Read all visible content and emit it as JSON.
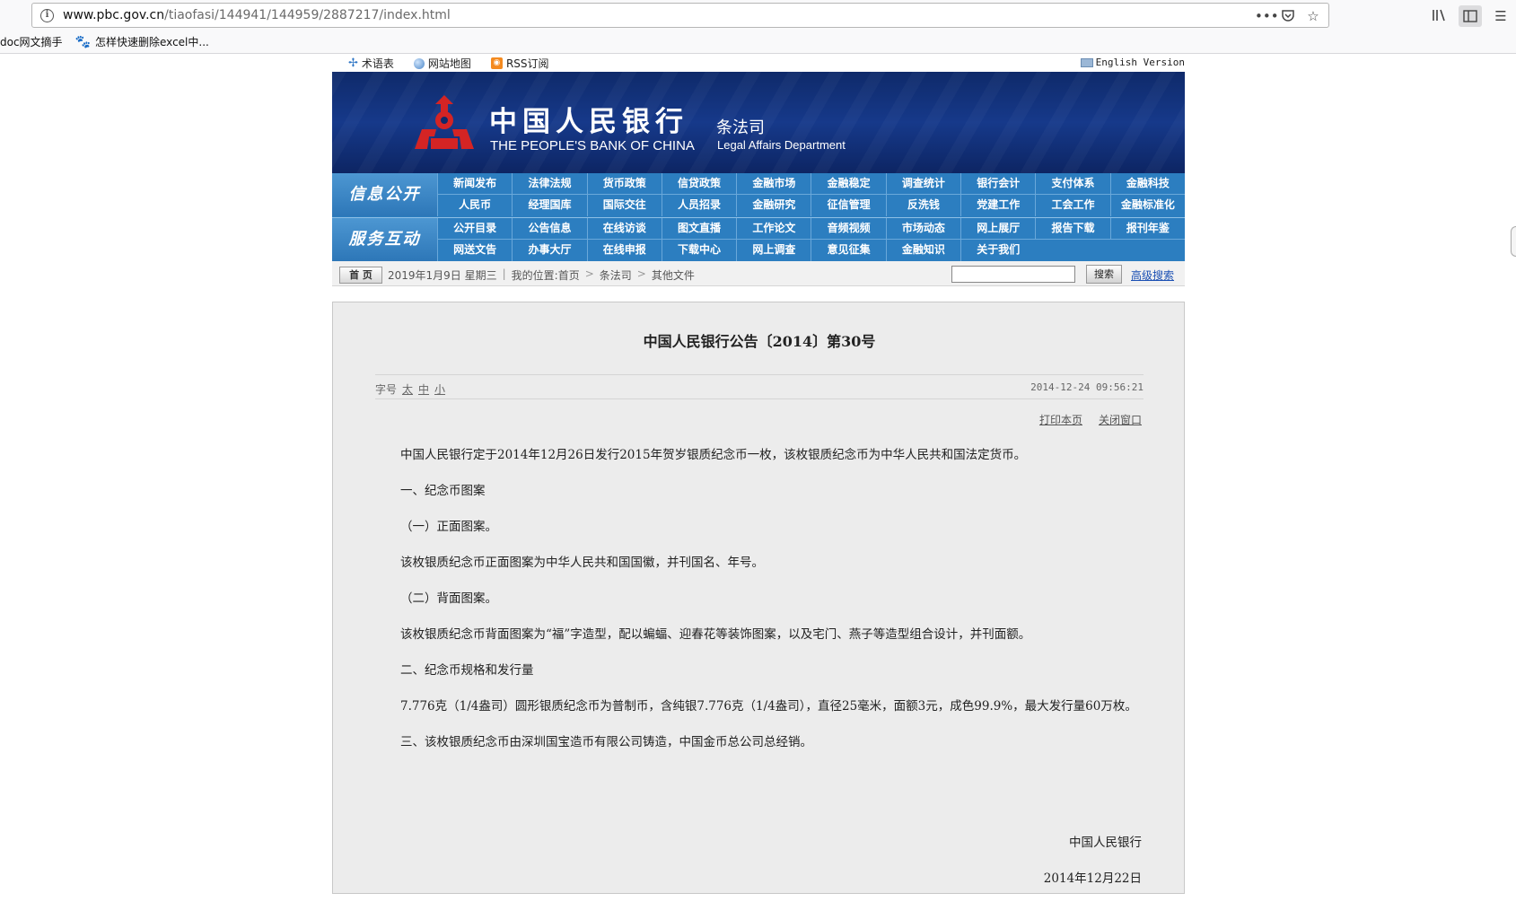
{
  "browser": {
    "url_host": "www.pbc.gov.cn",
    "url_path": "/tiaofasi/144941/144959/2887217/index.html",
    "bookmarks": [
      "doc网文摘手",
      "怎样快速删除excel中..."
    ]
  },
  "topbar": {
    "links": [
      "术语表",
      "网站地图",
      "RSS订阅"
    ],
    "english": "English Version"
  },
  "banner": {
    "bank_cn": "中国人民银行",
    "bank_en": "THE PEOPLE'S BANK OF CHINA",
    "dept_cn": "条法司",
    "dept_en": "Legal Affairs Department"
  },
  "nav": {
    "row1_tag": "信息公开",
    "row1_links": [
      "新闻发布",
      "法律法规",
      "货币政策",
      "信贷政策",
      "金融市场",
      "金融稳定",
      "调查统计",
      "银行会计",
      "支付体系",
      "金融科技",
      "人民币",
      "经理国库",
      "国际交往",
      "人员招录",
      "金融研究",
      "征信管理",
      "反洗钱",
      "党建工作",
      "工会工作",
      "金融标准化"
    ],
    "row2_tag": "服务互动",
    "row2_links": [
      "公开目录",
      "公告信息",
      "在线访谈",
      "图文直播",
      "工作论文",
      "音频视频",
      "市场动态",
      "网上展厅",
      "报告下载",
      "报刊年鉴",
      "网送文告",
      "办事大厅",
      "在线申报",
      "下载中心",
      "网上调查",
      "意见征集",
      "金融知识",
      "关于我们"
    ]
  },
  "crumbbar": {
    "home": "首 页",
    "date": "2019年1月9日 星期三",
    "location_label": "我的位置:首页",
    "crumbs": [
      "条法司",
      "其他文件"
    ],
    "search_button": "搜索",
    "advanced_search": "高级搜索"
  },
  "article": {
    "title": "中国人民银行公告〔2014〕第30号",
    "font_size_label": "字号",
    "font_sizes": [
      "太",
      "中",
      "小"
    ],
    "timestamp": "2014-12-24 09:56:21",
    "print": "打印本页",
    "close": "关闭窗口",
    "paragraphs": [
      "中国人民银行定于2014年12月26日发行2015年贺岁银质纪念币一枚，该枚银质纪念币为中华人民共和国法定货币。",
      "一、纪念币图案",
      "（一）正面图案。",
      "该枚银质纪念币正面图案为中华人民共和国国徽，并刊国名、年号。",
      "（二）背面图案。",
      "该枚银质纪念币背面图案为“福”字造型，配以蝙蝠、迎春花等装饰图案，以及宅门、燕子等造型组合设计，并刊面额。",
      "二、纪念币规格和发行量",
      "7.776克（1/4盎司）圆形银质纪念币为普制币，含纯银7.776克（1/4盎司），直径25毫米，面额3元，成色99.9%，最大发行量60万枚。",
      "三、该枚银质纪念币由深圳国宝造币有限公司铸造，中国金币总公司总经销。"
    ],
    "signature": "中国人民银行",
    "sign_date": "2014年12月22日"
  },
  "colors": {
    "banner": "#16398a",
    "nav": "#2c7ec0",
    "logo_red": "#d42424",
    "article_bg": "#ececec"
  }
}
